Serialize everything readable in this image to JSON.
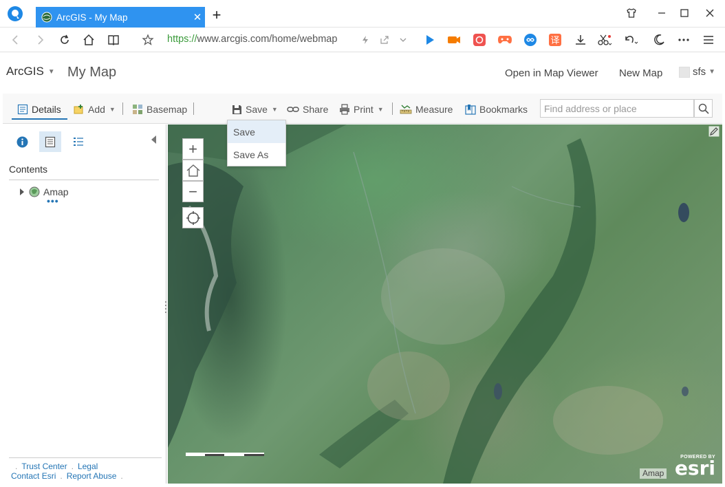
{
  "browser": {
    "tab_title": "ArcGIS - My Map",
    "tab_close": "✕",
    "new_tab": "+",
    "url_protocol": "https://",
    "url_rest": "www.arcgis.com/home/webmap",
    "extension_label": "译"
  },
  "header": {
    "brand": "ArcGIS",
    "map_title": "My Map",
    "open_in_viewer": "Open in Map Viewer",
    "new_map": "New Map",
    "user": "sfs"
  },
  "toolbar": {
    "details": "Details",
    "add": "Add",
    "basemap": "Basemap",
    "save": "Save",
    "share": "Share",
    "print": "Print",
    "measure": "Measure",
    "bookmarks": "Bookmarks",
    "search_placeholder": "Find address or place"
  },
  "save_menu": {
    "items": [
      "Save",
      "Save As"
    ]
  },
  "side": {
    "contents_title": "Contents",
    "layers": [
      {
        "name": "Amap"
      }
    ],
    "more": "•••",
    "footer": {
      "trust_center": "Trust Center",
      "legal": "Legal",
      "contact": "Contact Esri",
      "report_abuse": "Report Abuse"
    }
  },
  "map": {
    "zoom_in": "+",
    "zoom_out": "−",
    "attribution": "Amap",
    "powered_by": "POWERED BY",
    "esri": "esri"
  },
  "colors": {
    "accent": "#2475b5",
    "tab_blue": "#2f93f0",
    "url_green": "#3a9a3a"
  }
}
